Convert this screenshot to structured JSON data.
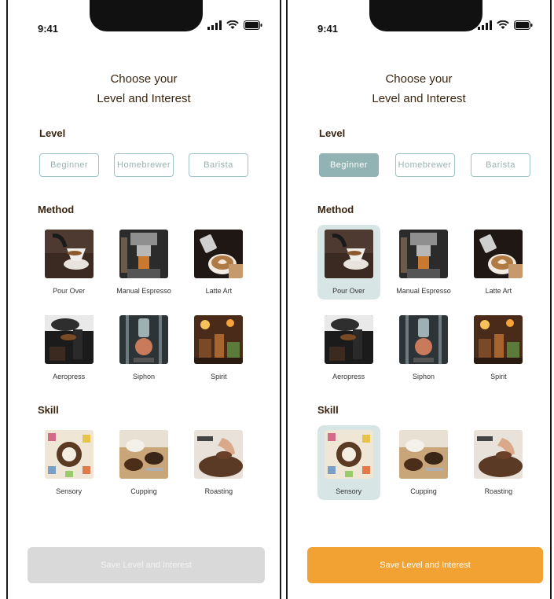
{
  "screens": [
    {
      "status": {
        "time": "9:41"
      },
      "title_line1": "Choose your",
      "title_line2": "Level and Interest",
      "level": {
        "label": "Level",
        "options": [
          "Beginner",
          "Homebrewer",
          "Barista"
        ],
        "selected": null
      },
      "method": {
        "label": "Method",
        "items": [
          "Pour Over",
          "Manual Espresso",
          "Latte Art",
          "Aeropress",
          "Siphon",
          "Spirit"
        ],
        "selected": []
      },
      "skill": {
        "label": "Skill",
        "items": [
          "Sensory",
          "Cupping",
          "Roasting"
        ],
        "selected": []
      },
      "save_button": {
        "label": "Save Level and Interest",
        "state": "disabled"
      }
    },
    {
      "status": {
        "time": "9:41"
      },
      "title_line1": "Choose your",
      "title_line2": "Level and Interest",
      "level": {
        "label": "Level",
        "options": [
          "Beginner",
          "Homebrewer",
          "Barista"
        ],
        "selected": "Beginner"
      },
      "method": {
        "label": "Method",
        "items": [
          "Pour Over",
          "Manual Espresso",
          "Latte Art",
          "Aeropress",
          "Siphon",
          "Spirit"
        ],
        "selected": [
          "Pour Over"
        ]
      },
      "skill": {
        "label": "Skill",
        "items": [
          "Sensory",
          "Cupping",
          "Roasting"
        ],
        "selected": [
          "Sensory"
        ]
      },
      "save_button": {
        "label": "Save Level and Interest",
        "state": "active"
      }
    }
  ],
  "colors": {
    "accent_teal": "#92b3b3",
    "selected_tile_bg": "#d7e5e5",
    "save_active": "#f2a233",
    "save_disabled": "#d9d9d9",
    "heading_brown": "#3a2610"
  },
  "icons": [
    "cellular-signal-icon",
    "wifi-icon",
    "battery-icon"
  ]
}
